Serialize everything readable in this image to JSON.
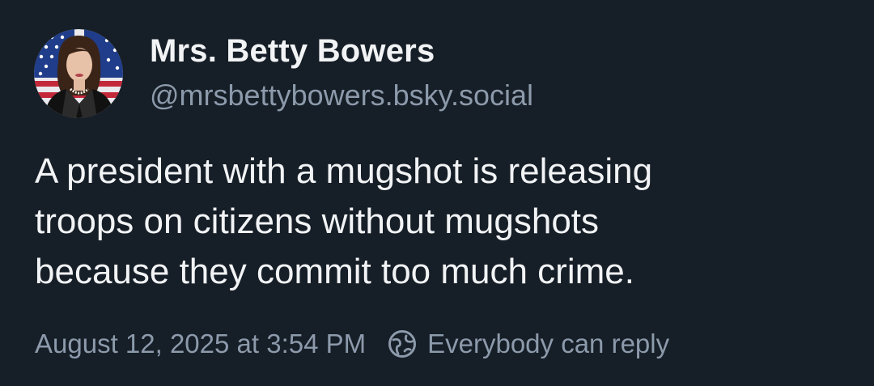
{
  "post": {
    "author": {
      "display_name": "Mrs. Betty Bowers",
      "handle": "@mrsbettybowers.bsky.social",
      "avatar_icon": "profile-photo"
    },
    "text_lines": [
      "A president with a mugshot is releasing",
      "troops on citizens without mugshots",
      "because they commit too much crime."
    ],
    "timestamp": "August 12, 2025 at 3:54 PM",
    "reply_setting": {
      "icon": "globe-icon",
      "label": "Everybody can reply"
    }
  },
  "colors": {
    "background": "#161e27",
    "primary_text": "#f1f3f5",
    "secondary_text": "#8c9aab"
  }
}
